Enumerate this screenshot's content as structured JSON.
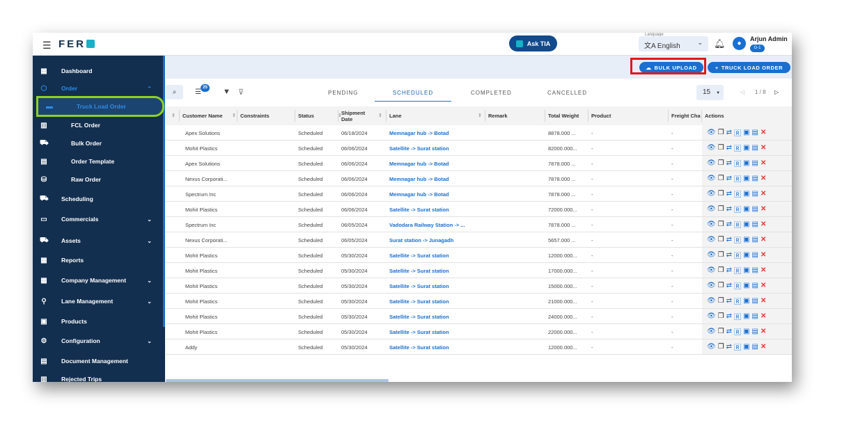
{
  "header": {
    "logo": "FER",
    "ask_tia": "Ask TIA",
    "language_label": "Language",
    "language": "English",
    "user_name": "Arjun Admin",
    "user_badge": "G-1"
  },
  "sidebar": {
    "items": [
      {
        "label": "Dashboard",
        "icon": "dashboard-icon"
      },
      {
        "label": "Order",
        "icon": "order-icon",
        "expanded": true
      },
      {
        "label": "Truck Load Order",
        "icon": "truck-load-icon",
        "active": true
      },
      {
        "label": "FCL Order",
        "icon": "container-icon"
      },
      {
        "label": "Bulk Order",
        "icon": "truck-icon"
      },
      {
        "label": "Order Template",
        "icon": "document-icon"
      },
      {
        "label": "Raw Order",
        "icon": "database-icon"
      },
      {
        "label": "Scheduling",
        "icon": "scheduling-icon"
      },
      {
        "label": "Commercials",
        "icon": "money-icon"
      },
      {
        "label": "Assets",
        "icon": "truck-icon"
      },
      {
        "label": "Reports",
        "icon": "reports-icon"
      },
      {
        "label": "Company Management",
        "icon": "company-icon"
      },
      {
        "label": "Lane Management",
        "icon": "lane-icon"
      },
      {
        "label": "Products",
        "icon": "products-icon"
      },
      {
        "label": "Configuration",
        "icon": "gear-icon"
      },
      {
        "label": "Document Management",
        "icon": "document-icon"
      },
      {
        "label": "Rejected Trips",
        "icon": "rejected-icon"
      }
    ]
  },
  "actions": {
    "bulk_upload": "BULK UPLOAD",
    "truck_load_order": "TRUCK LOAD ORDER"
  },
  "toolbar": {
    "column_count": "25",
    "tabs": [
      "PENDING",
      "SCHEDULED",
      "COMPLETED",
      "CANCELLED"
    ],
    "active_tab": "SCHEDULED",
    "page_size": "15",
    "page": "1 / 8"
  },
  "table": {
    "columns": [
      "Customer Name",
      "Constraints",
      "Status",
      "Shipment Date",
      "Lane",
      "Remark",
      "Total Weight",
      "Product",
      "Freight Cha",
      "Actions"
    ],
    "rows": [
      [
        "Apex Solutions",
        "",
        "Scheduled",
        "06/18/2024",
        "Memnagar hub -> Botad",
        "",
        "8878.000 ...",
        "-",
        "-"
      ],
      [
        "Mohit Plastics",
        "",
        "Scheduled",
        "06/06/2024",
        "Satellite -> Surat station",
        "",
        "82000.000...",
        "-",
        "-"
      ],
      [
        "Apex Solutions",
        "",
        "Scheduled",
        "06/06/2024",
        "Memnagar hub -> Botad",
        "",
        "7878.000 ...",
        "-",
        "-"
      ],
      [
        "Nexus Corporati...",
        "",
        "Scheduled",
        "06/06/2024",
        "Memnagar hub -> Botad",
        "",
        "7878.000 ...",
        "-",
        "-"
      ],
      [
        "Spectrum Inc",
        "",
        "Scheduled",
        "06/06/2024",
        "Memnagar hub -> Botad",
        "",
        "7878.000 ...",
        "-",
        "-"
      ],
      [
        "Mohit Plastics",
        "",
        "Scheduled",
        "06/06/2024",
        "Satellite -> Surat station",
        "",
        "72000.000...",
        "-",
        "-"
      ],
      [
        "Spectrum Inc",
        "",
        "Scheduled",
        "06/05/2024",
        "Vadodara Railway Station -> ...",
        "",
        "7878.000 ...",
        "-",
        "-"
      ],
      [
        "Nexus Corporati...",
        "",
        "Scheduled",
        "06/05/2024",
        "Surat station -> Junagadh",
        "",
        "5657.000 ...",
        "-",
        "-"
      ],
      [
        "Mohit Plastics",
        "",
        "Scheduled",
        "05/30/2024",
        "Satellite -> Surat station",
        "",
        "12000.000...",
        "-",
        "-"
      ],
      [
        "Mohit Plastics",
        "",
        "Scheduled",
        "05/30/2024",
        "Satellite -> Surat station",
        "",
        "17000.000...",
        "-",
        "-"
      ],
      [
        "Mohit Plastics",
        "",
        "Scheduled",
        "05/30/2024",
        "Satellite -> Surat station",
        "",
        "15000.000...",
        "-",
        "-"
      ],
      [
        "Mohit Plastics",
        "",
        "Scheduled",
        "05/30/2024",
        "Satellite -> Surat station",
        "",
        "21000.000...",
        "-",
        "-"
      ],
      [
        "Mohit Plastics",
        "",
        "Scheduled",
        "05/30/2024",
        "Satellite -> Surat station",
        "",
        "24000.000...",
        "-",
        "-"
      ],
      [
        "Mohit Plastics",
        "",
        "Scheduled",
        "05/30/2024",
        "Satellite -> Surat station",
        "",
        "22000.000...",
        "-",
        "-"
      ],
      [
        "Addy",
        "",
        "Scheduled",
        "05/30/2024",
        "Satellite -> Surat station",
        "",
        "12000.000...",
        "-",
        "-"
      ]
    ]
  },
  "colors": {
    "sidebar": "#132f4f",
    "accent": "#1a6fcf",
    "highlight_green": "#8ed11f",
    "highlight_red": "#e01919",
    "delete": "#e53935"
  }
}
